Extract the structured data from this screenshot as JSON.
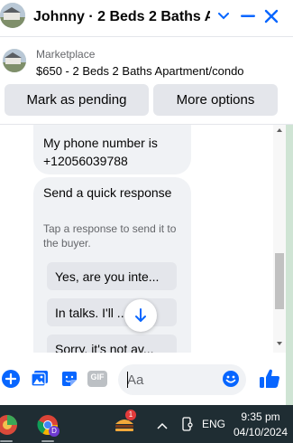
{
  "header": {
    "title": "Johnny · 2 Beds 2 Baths A...",
    "chevron_icon": "chevron-down-icon",
    "minimize_icon": "minimize-icon",
    "close_icon": "close-icon"
  },
  "listing": {
    "source_label": "Marketplace",
    "summary": "$650 - 2 Beds 2 Baths Apartment/condo",
    "buttons": {
      "pending_label": "Mark as pending",
      "more_label": "More options"
    }
  },
  "messages": {
    "phone_message": "My phone number is +12056039788",
    "quick_response": {
      "title": "Send a quick response",
      "subtitle": "Tap a response to send it to the buyer.",
      "options": [
        "Yes, are you inte...",
        "In talks. I'll ...",
        "Sorry, it's not av..."
      ]
    }
  },
  "composer": {
    "placeholder": "Aa",
    "gif_label": "GIF",
    "icons": [
      "plus-circle-icon",
      "photo-icon",
      "sticker-icon",
      "gif-icon",
      "emoji-icon",
      "thumbs-up-icon"
    ]
  },
  "taskbar": {
    "notification_count": "1",
    "profile_initial": "D",
    "language": "ENG",
    "time": "9:35 pm",
    "date": "04/10/2024"
  },
  "colors": {
    "accent": "#0866ff",
    "bubble": "#f0f2f5",
    "button": "#e4e6eb",
    "taskbar": "#1f2d33"
  }
}
